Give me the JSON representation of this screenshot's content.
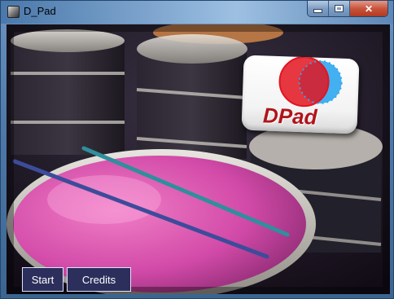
{
  "window": {
    "title": "D_Pad",
    "controls": {
      "minimize": "minimize",
      "maximize": "maximize",
      "close": "✕"
    }
  },
  "logo": {
    "text": "DPad"
  },
  "buttons": {
    "start": "Start",
    "credits": "Credits"
  },
  "colors": {
    "button_bg": "#2c2f5c",
    "logo_red": "#e3141e",
    "logo_blue": "#2fa7f0",
    "drumhead": "#d24aa8"
  }
}
